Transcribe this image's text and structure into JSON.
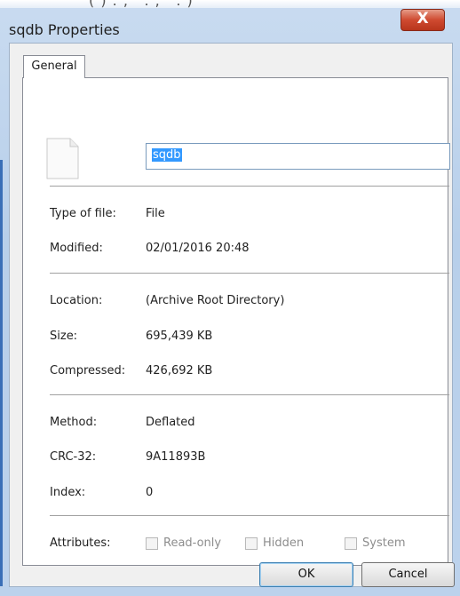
{
  "window": {
    "title": "sqdb Properties",
    "close_glyph": "X",
    "top_residue": "( ) . , ' . , ' . )"
  },
  "tabs": [
    {
      "label": "General",
      "active": true
    }
  ],
  "file": {
    "name": "sqdb",
    "icon": "document-icon"
  },
  "properties": {
    "type_label": "Type of file:",
    "type_value": "File",
    "modified_label": "Modified:",
    "modified_value": "02/01/2016 20:48",
    "location_label": "Location:",
    "location_value": "(Archive Root Directory)",
    "size_label": "Size:",
    "size_value": "695,439 KB",
    "compressed_label": "Compressed:",
    "compressed_value": "426,692 KB",
    "method_label": "Method:",
    "method_value": "Deflated",
    "crc_label": "CRC-32:",
    "crc_value": "9A11893B",
    "index_label": "Index:",
    "index_value": "0"
  },
  "attributes": {
    "label": "Attributes:",
    "items": [
      {
        "label": "Read-only",
        "checked": false
      },
      {
        "label": "Hidden",
        "checked": false
      },
      {
        "label": "System",
        "checked": false
      }
    ]
  },
  "buttons": {
    "ok": "OK",
    "cancel": "Cancel"
  },
  "colors": {
    "titlebar": "#bcd2ec",
    "close_button": "#cf4a30",
    "selection": "#3399ff"
  }
}
